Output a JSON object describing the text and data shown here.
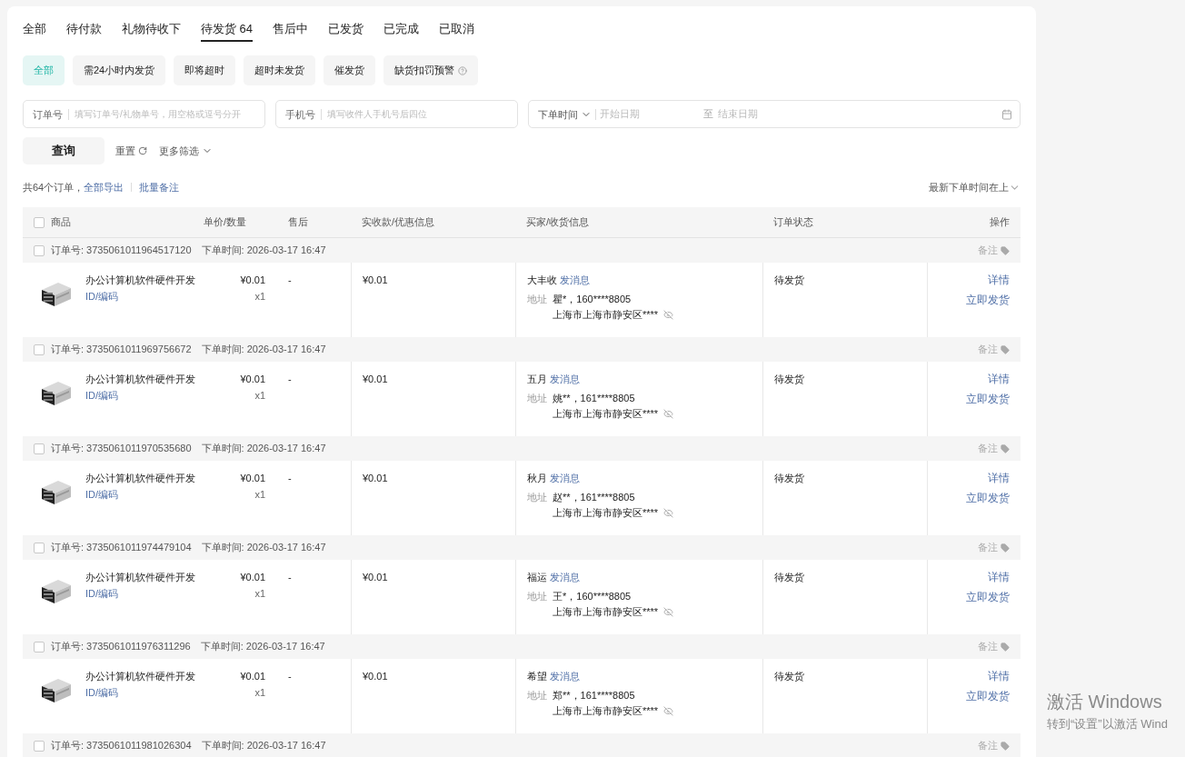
{
  "status_tabs": [
    {
      "label": "全部",
      "selected": false
    },
    {
      "label": "待付款",
      "selected": false
    },
    {
      "label": "礼物待收下",
      "selected": false
    },
    {
      "label": "待发货 64",
      "selected": true
    },
    {
      "label": "售后中",
      "selected": false
    },
    {
      "label": "已发货",
      "selected": false
    },
    {
      "label": "已完成",
      "selected": false
    },
    {
      "label": "已取消",
      "selected": false
    }
  ],
  "filter_chips": [
    {
      "label": "全部",
      "selected": true,
      "has_help": false
    },
    {
      "label": "需24小时内发货",
      "selected": false,
      "has_help": false
    },
    {
      "label": "即将超时",
      "selected": false,
      "has_help": false
    },
    {
      "label": "超时未发货",
      "selected": false,
      "has_help": false
    },
    {
      "label": "催发货",
      "selected": false,
      "has_help": false
    },
    {
      "label": "缺货扣罚预警",
      "selected": false,
      "has_help": true
    }
  ],
  "search": {
    "order_field": {
      "label": "订单号",
      "placeholder": "填写订单号/礼物单号，用空格或逗号分开"
    },
    "phone_field": {
      "label": "手机号",
      "placeholder": "填写收件人手机号后四位"
    },
    "date_range": {
      "selector": "下单时间",
      "start_placeholder": "开始日期",
      "separator": "至",
      "end_placeholder": "结束日期"
    }
  },
  "actions": {
    "query": "查询",
    "reset": "重置",
    "more_filters": "更多筛选"
  },
  "summary": {
    "count_text": "共64个订单，",
    "export": "全部导出",
    "batch_note": "批量备注"
  },
  "sort": "最新下单时间在上",
  "table": {
    "select_all": {
      "checked": false
    },
    "columns": [
      "商品",
      "单价/数量",
      "售后",
      "实收款/优惠信息",
      "买家/收货信息",
      "订单状态",
      "操作"
    ],
    "orders": [
      {
        "checked": false,
        "order_no": "订单号: 3735061011964517120",
        "order_time": "下单时间: 2026-03-17 16:47",
        "note": "备注",
        "product": {
          "kind": "picture",
          "name": "办公计算机软件硬件开发",
          "code": "ID/编码",
          "price": "¥0.01",
          "quantity": "x1",
          "after_sale": "-",
          "amount": "¥0.01"
        },
        "buyer": {
          "name": "大丰收",
          "message": "发消息",
          "address_label": "地址",
          "recipient": "瞿*，160****8805",
          "address": "上海市上海市静安区****"
        },
        "status": "待发货",
        "operations": [
          "详情",
          "立即发货"
        ]
      },
      {
        "checked": false,
        "order_no": "订单号: 3735061011969756672",
        "order_time": "下单时间: 2026-03-17 16:47",
        "note": "备注",
        "product": {
          "kind": "picture",
          "name": "办公计算机软件硬件开发",
          "code": "ID/编码",
          "price": "¥0.01",
          "quantity": "x1",
          "after_sale": "-",
          "amount": "¥0.01"
        },
        "buyer": {
          "name": "五月",
          "message": "发消息",
          "address_label": "地址",
          "recipient": "姚**，161****8805",
          "address": "上海市上海市静安区****"
        },
        "status": "待发货",
        "operations": [
          "详情",
          "立即发货"
        ]
      },
      {
        "checked": false,
        "order_no": "订单号: 3735061011970535680",
        "order_time": "下单时间: 2026-03-17 16:47",
        "note": "备注",
        "product": {
          "kind": "picture",
          "name": "办公计算机软件硬件开发",
          "code": "ID/编码",
          "price": "¥0.01",
          "quantity": "x1",
          "after_sale": "-",
          "amount": "¥0.01"
        },
        "buyer": {
          "name": "秋月",
          "message": "发消息",
          "address_label": "地址",
          "recipient": "赵**，161****8805",
          "address": "上海市上海市静安区****"
        },
        "status": "待发货",
        "operations": [
          "详情",
          "立即发货"
        ]
      },
      {
        "checked": false,
        "order_no": "订单号: 3735061011974479104",
        "order_time": "下单时间: 2026-03-17 16:47",
        "note": "备注",
        "product": {
          "kind": "picture",
          "name": "办公计算机软件硬件开发",
          "code": "ID/编码",
          "price": "¥0.01",
          "quantity": "x1",
          "after_sale": "-",
          "amount": "¥0.01"
        },
        "buyer": {
          "name": "福运",
          "message": "发消息",
          "address_label": "地址",
          "recipient": "王*，160****8805",
          "address": "上海市上海市静安区****"
        },
        "status": "待发货",
        "operations": [
          "详情",
          "立即发货"
        ]
      },
      {
        "checked": false,
        "order_no": "订单号: 3735061011976311296",
        "order_time": "下单时间: 2026-03-17 16:47",
        "note": "备注",
        "product": {
          "kind": "picture",
          "name": "办公计算机软件硬件开发",
          "code": "ID/编码",
          "price": "¥0.01",
          "quantity": "x1",
          "after_sale": "-",
          "amount": "¥0.01"
        },
        "buyer": {
          "name": "希望",
          "message": "发消息",
          "address_label": "地址",
          "recipient": "郑**，161****8805",
          "address": "上海市上海市静安区****"
        },
        "status": "待发货",
        "operations": [
          "详情",
          "立即发货"
        ]
      },
      {
        "checked": false,
        "order_no": "订单号: 3735061011981026304",
        "order_time": "下单时间: 2026-03-17 16:47",
        "note": "备注"
      }
    ]
  },
  "os_notice": {
    "title": "激活 Windows",
    "subtitle": "转到“设置”以激活 Wind"
  }
}
